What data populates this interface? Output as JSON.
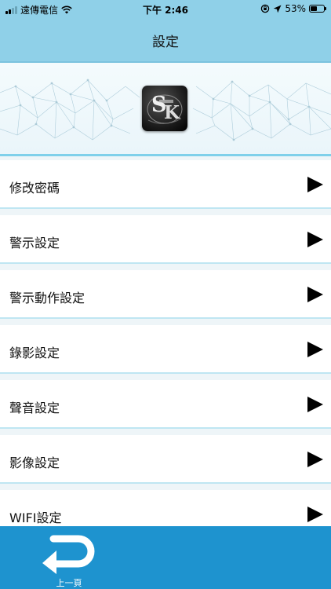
{
  "status_bar": {
    "carrier": "遠傳電信",
    "time": "下午 2:46",
    "battery": "53%",
    "battery_level": 0.53,
    "icons": [
      "signal-icon",
      "wifi-icon",
      "orientation-lock-icon",
      "location-arrow-icon",
      "battery-icon"
    ]
  },
  "nav": {
    "title": "設定"
  },
  "banner": {
    "logo_name": "sk-logo"
  },
  "menu": {
    "items": [
      {
        "label": "修改密碼",
        "icon": "play-arrow-icon"
      },
      {
        "label": "警示設定",
        "icon": "play-arrow-icon"
      },
      {
        "label": "警示動作設定",
        "icon": "play-arrow-icon"
      },
      {
        "label": "錄影設定",
        "icon": "play-arrow-icon"
      },
      {
        "label": "聲音設定",
        "icon": "play-arrow-icon"
      },
      {
        "label": "影像設定",
        "icon": "play-arrow-icon"
      },
      {
        "label": "WIFI設定",
        "icon": "play-arrow-icon"
      }
    ]
  },
  "bottom": {
    "back_label": "上一頁",
    "back_icon": "return-arrow-icon"
  },
  "colors": {
    "nav_bg": "#8fd0e8",
    "bottom_bg": "#1e93cf",
    "divider": "#bfe6f2"
  }
}
